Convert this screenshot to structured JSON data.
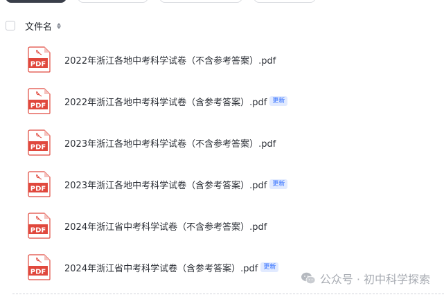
{
  "header": {
    "column_name": "文件名"
  },
  "files": [
    {
      "name": "2022年浙江各地中考科学试卷（不含参考答案）.pdf",
      "badge": "",
      "icon": "pdf-icon"
    },
    {
      "name": "2022年浙江各地中考科学试卷（含参考答案）.pdf",
      "badge": "更新",
      "icon": "pdf-icon"
    },
    {
      "name": "2023年浙江各地中考科学试卷（不含参考答案）.pdf",
      "badge": "",
      "icon": "pdf-icon"
    },
    {
      "name": "2023年浙江各地中考科学试卷（含参考答案）.pdf",
      "badge": "更新",
      "icon": "pdf-icon"
    },
    {
      "name": "2024年浙江省中考科学试卷（不含参考答案）.pdf",
      "badge": "",
      "icon": "pdf-icon"
    },
    {
      "name": "2024年浙江省中考科学试卷（含参考答案）.pdf",
      "badge": "更新",
      "icon": "pdf-icon"
    }
  ],
  "pdf_icon_label": "PDF",
  "watermark": {
    "text": "公众号 · 初中科学探索"
  },
  "colors": {
    "pdf_red": "#e0483d",
    "badge_text": "#3370ff",
    "badge_bg": "#e1eaff"
  }
}
